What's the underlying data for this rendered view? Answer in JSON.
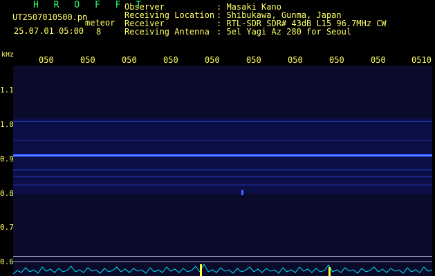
{
  "header": {
    "title": "H R O F F T",
    "filename": "UT2507010500.pn",
    "meteor_label": "meteor",
    "datetime": "25.07.01 05:00",
    "count": "8"
  },
  "info": [
    {
      "label": "Observer",
      "value": ": Masaki Kano"
    },
    {
      "label": "Receiving Location",
      "value": ": Shibukawa, Gunma, Japan"
    },
    {
      "label": "Receiver",
      "value": ": RTL-SDR SDR# 43dB L15 96.7MHz CW"
    },
    {
      "label": "Receiving Antenna",
      "value": ": 5el Yagi Az 280 for Seoul"
    }
  ],
  "axis": {
    "y_unit": "kHz",
    "y_ticks": [
      "1.1",
      "1.0",
      "0.9",
      "0.8",
      "0.7",
      "0.6"
    ],
    "x_ticks": [
      "050",
      "050",
      "050",
      "050",
      "050",
      "050",
      "050",
      "050",
      "050",
      "0510"
    ]
  },
  "colors": {
    "text_yellow": "#ffff66",
    "title_green": "#33ff66",
    "background": "#000000",
    "plot_bg": "#0a0a28",
    "signal_blue": "#3355ff",
    "spectrum_cyan": "#00e5ff"
  }
}
